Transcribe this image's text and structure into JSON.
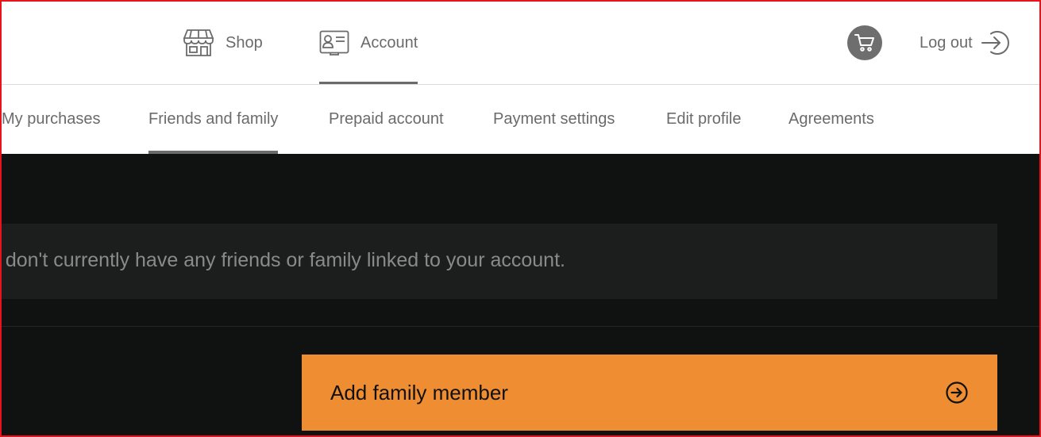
{
  "header": {
    "nav": [
      {
        "label": "Shop",
        "icon": "storefront-icon"
      },
      {
        "label": "Account",
        "icon": "id-card-icon",
        "active": true
      }
    ],
    "cart_icon": "cart-icon",
    "logout_label": "Log out",
    "logout_icon": "arrow-circle-right-icon"
  },
  "subnav": {
    "items": [
      {
        "label": "My purchases"
      },
      {
        "label": "Friends and family",
        "active": true
      },
      {
        "label": "Prepaid account"
      },
      {
        "label": "Payment settings"
      },
      {
        "label": "Edit profile"
      },
      {
        "label": "Agreements"
      }
    ]
  },
  "main": {
    "notice_text": "u don't currently have any friends or family linked to your account.",
    "add_button_label": "Add family member",
    "add_button_icon": "arrow-circle-right-icon"
  },
  "colors": {
    "accent": "#ef8d33",
    "dark_bg": "#101111",
    "panel_bg": "#1c1d1d",
    "nav_text": "#6b6b6b",
    "frame_border": "#e8141b"
  }
}
